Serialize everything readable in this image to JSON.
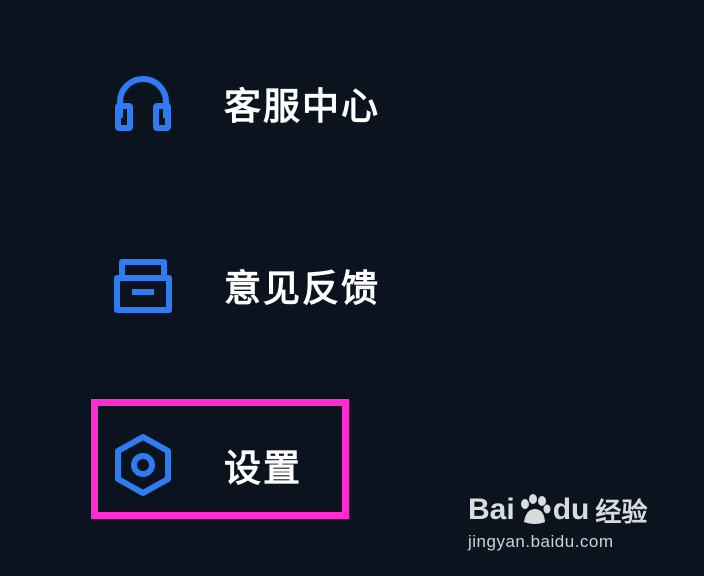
{
  "menu": {
    "items": [
      {
        "id": "service",
        "label": "客服中心",
        "icon": "headset-icon"
      },
      {
        "id": "feedback",
        "label": "意见反馈",
        "icon": "feedback-tray-icon"
      },
      {
        "id": "settings",
        "label": "设置",
        "icon": "hexagon-gear-icon",
        "highlighted": true
      }
    ]
  },
  "colors": {
    "background": "#0b131f",
    "icon": "#2f7bf0",
    "label": "#ffffff",
    "highlight": "#ff2bd0"
  },
  "watermark": {
    "brand_part1": "Bai",
    "brand_part2": "du",
    "product": "经验",
    "url": "jingyan.baidu.com"
  }
}
